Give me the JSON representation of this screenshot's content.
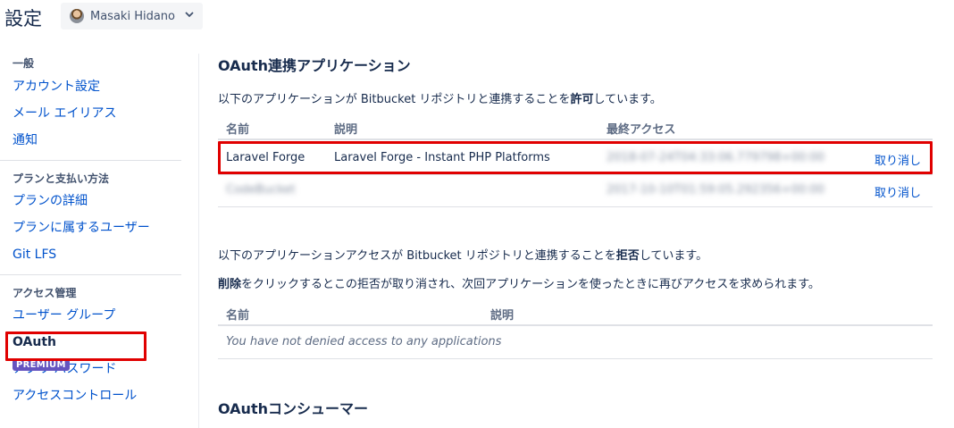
{
  "header": {
    "title": "設定",
    "account_name": "Masaki Hidano"
  },
  "sidebar": {
    "sections": [
      {
        "heading": "一般",
        "items": [
          "アカウント設定",
          "メール エイリアス",
          "通知"
        ]
      },
      {
        "heading": "プランと支払い方法",
        "items": [
          "プランの詳細",
          "プランに属するユーザー",
          "Git LFS"
        ]
      },
      {
        "heading": "アクセス管理",
        "items": [
          "ユーザー グループ",
          "OAuth",
          "アプリ パスワード",
          "アクセスコントロール"
        ]
      }
    ],
    "active_item": "OAuth",
    "premium_badge": "PREMIUM"
  },
  "oauth_apps": {
    "title": "OAuth連携アプリケーション",
    "intro_before": "以下のアプリケーションが Bitbucket リポジトリと連携することを",
    "intro_bold": "許可",
    "intro_after": "しています。",
    "columns": [
      "名前",
      "説明",
      "最終アクセス"
    ],
    "rows": [
      {
        "name": "Laravel Forge",
        "description": "Laravel Forge - Instant PHP Platforms",
        "last_access": "2018-07-24T04:33:06.779798+00:00",
        "action": "取り消し"
      },
      {
        "name": "CodeBucket",
        "description": "",
        "last_access": "2017-10-10T01:59:05.292356+00:00",
        "action": "取り消し"
      }
    ]
  },
  "denied_apps": {
    "intro_before": "以下のアプリケーションアクセスが Bitbucket リポジトリと連携することを",
    "intro_bold": "拒否",
    "intro_after": "しています。",
    "note_bold": "削除",
    "note_rest": "をクリックするとこの拒否が取り消され、次回アプリケーションを使ったときに再びアクセスを求められます。",
    "columns": [
      "名前",
      "説明"
    ],
    "empty_message": "You have not denied access to any applications"
  },
  "oauth_consumers": {
    "title": "OAuthコンシューマー"
  },
  "colors": {
    "link": "#0052cc",
    "highlight": "#e00000",
    "premium": "#6554c0"
  }
}
